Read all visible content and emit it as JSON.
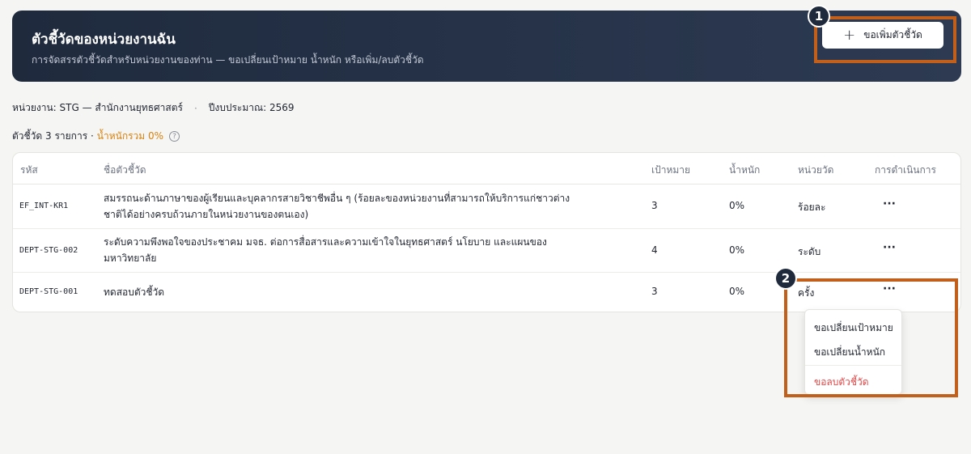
{
  "header": {
    "title": "ตัวชี้วัดของหน่วยงานฉัน",
    "subtitle": "การจัดสรรตัวชี้วัดสำหรับหน่วยงานของท่าน — ขอเปลี่ยนเป้าหมาย น้ำหนัก หรือเพิ่ม/ลบตัวชี้วัด",
    "add_button_label": "ขอเพิ่มตัวชี้วัด",
    "add_button_icon": "plus-icon"
  },
  "meta": {
    "unit": "หน่วยงาน: STG — สำนักงานยุทธศาสตร์",
    "separator": "·",
    "fiscal_year": "ปีงบประมาณ: 2569"
  },
  "summary": {
    "count": "ตัวชี้วัด 3 รายการ ·",
    "total_weight": "น้ำหนักรวม 0%",
    "info_icon": "info-icon"
  },
  "table": {
    "columns": [
      "รหัส",
      "ชื่อตัวชี้วัด",
      "เป้าหมาย",
      "น้ำหนัก",
      "หน่วยวัด",
      "การดำเนินการ"
    ],
    "rows": [
      {
        "code": "EF_INT-KR1",
        "name_line1": "สมรรถนะด้านภาษาของผู้เรียนและบุคลากรสายวิชาชีพอื่น ๆ (ร้อยละของหน่วยงานที่สามารถให้บริการแก่ชาวต่าง",
        "name_line2": "ชาติได้อย่างครบถ้วนภายในหน่วยงานของตนเอง)",
        "target": "3",
        "weight": "0%",
        "unit": "ร้อยละ",
        "actions": "···"
      },
      {
        "code": "DEPT-STG-002",
        "name_line1": "ระดับความพึงพอใจของประชาคม มจธ. ต่อการสื่อสารและความเข้าใจในยุทธศาสตร์ นโยบาย และแผนของ",
        "name_line2": "มหาวิทยาลัย",
        "target": "4",
        "weight": "0%",
        "unit": "ระดับ",
        "actions": "···"
      },
      {
        "code": "DEPT-STG-001",
        "name_line1": "ทดสอบตัวชี้วัด",
        "name_line2": "",
        "target": "3",
        "weight": "0%",
        "unit": "ครั้ง",
        "actions": "···"
      }
    ]
  },
  "menu": {
    "items": [
      "ขอเปลี่ยนเป้าหมาย",
      "ขอเปลี่ยนน้ำหนัก",
      "ขอลบตัวชี้วัด"
    ]
  },
  "annotations": {
    "badge_1": "1",
    "badge_2": "2",
    "highlight_color": "#c2601b"
  },
  "colors": {
    "banner": "#1f2a3d",
    "accent_weight": "#d9820e",
    "danger": "#e04848"
  }
}
